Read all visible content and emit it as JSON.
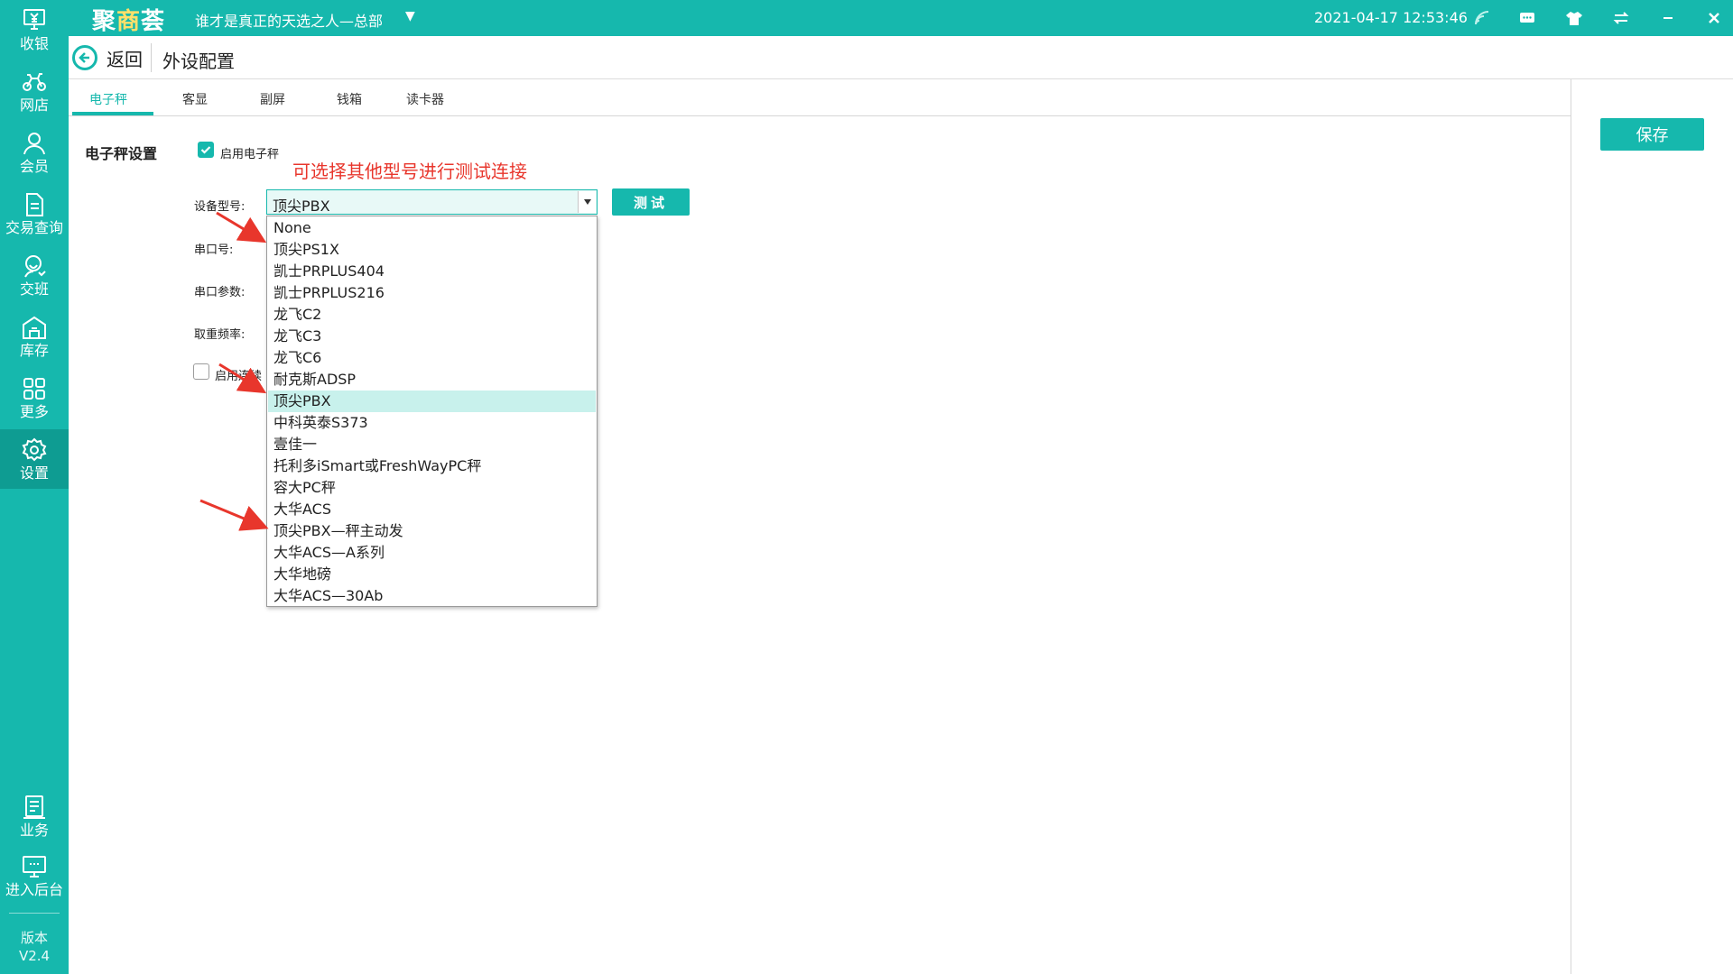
{
  "app": {
    "brand_a": "聚",
    "brand_b": "商",
    "brand_c": "荟",
    "store_name": "谁才是真正的天选之人—总部",
    "datetime": "2021-04-17 12:53:46"
  },
  "sidebar": {
    "items": [
      {
        "label": "收银",
        "icon": "cashier-icon"
      },
      {
        "label": "网店",
        "icon": "bike-icon"
      },
      {
        "label": "会员",
        "icon": "user-icon"
      },
      {
        "label": "交易查询",
        "icon": "document-icon"
      },
      {
        "label": "交班",
        "icon": "shift-icon"
      },
      {
        "label": "库存",
        "icon": "warehouse-icon"
      },
      {
        "label": "更多",
        "icon": "grid-icon"
      },
      {
        "label": "设置",
        "icon": "gear-icon"
      }
    ],
    "bottom_items": [
      {
        "label": "业务",
        "icon": "clipboard-icon"
      },
      {
        "label": "进入后台",
        "icon": "monitor-icon"
      }
    ],
    "version_label": "版本",
    "version_value": "V2.4"
  },
  "header": {
    "back_label": "返回",
    "title": "外设配置"
  },
  "tabs": [
    "电子秤",
    "客显",
    "副屏",
    "钱箱",
    "读卡器"
  ],
  "active_tab": "电子秤",
  "save_label": "保存",
  "form": {
    "section_title": "电子秤设置",
    "enable_scale_label": "启用电子秤",
    "enable_scale_checked": true,
    "annotation": "可选择其他型号进行测试连接",
    "device_model_label": "设备型号:",
    "device_model_value": "顶尖PBX",
    "test_label": "测试",
    "serial_port_label": "串口号:",
    "serial_params_label": "串口参数:",
    "weigh_freq_label": "取重频率:",
    "continuous_label": "启用连续",
    "continuous_checked": false
  },
  "dropdown_options": [
    "None",
    "顶尖PS1X",
    "凯士PRPLUS404",
    "凯士PRPLUS216",
    "龙飞C2",
    "龙飞C3",
    "龙飞C6",
    "耐克斯ADSP",
    "顶尖PBX",
    "中科英泰S373",
    "壹佳一",
    "托利多iSmart或FreshWayPC秤",
    "容大PC秤",
    "大华ACS",
    "顶尖PBX—秤主动发",
    "大华ACS—A系列",
    "大华地磅",
    "大华ACS—30Ab"
  ],
  "selected_option": "顶尖PBX",
  "colors": {
    "brand": "#16b8ad",
    "annotation": "#e8362c",
    "selected_row": "#c8f1ec"
  },
  "top_icons": [
    "wifi-icon",
    "message-icon",
    "shirt-icon",
    "sync-icon",
    "minimize-icon",
    "close-icon"
  ]
}
